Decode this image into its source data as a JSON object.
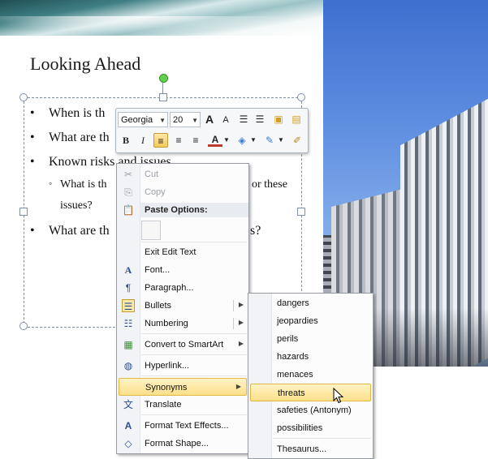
{
  "slide": {
    "title": "Looking Ahead",
    "bullets": [
      "When is th",
      "What are th",
      "Known risks and issues",
      "What is th",
      "or these",
      "issues?",
      "What are th",
      "s?"
    ]
  },
  "mini_toolbar": {
    "font_name": "Georgia",
    "font_size": "20",
    "grow_font": "A",
    "shrink_font": "A",
    "bold": "B",
    "italic": "I",
    "font_color_letter": "A",
    "accent_color": "#c0392b"
  },
  "context_menu": {
    "items": [
      {
        "label": "Cut",
        "disabled": true
      },
      {
        "label": "Copy",
        "disabled": true
      },
      {
        "label": "Paste Options:",
        "header": true
      },
      {
        "label": "Exit Edit Text"
      },
      {
        "label": "Font..."
      },
      {
        "label": "Paragraph..."
      },
      {
        "label": "Bullets"
      },
      {
        "label": "Numbering"
      },
      {
        "label": "Convert to SmartArt"
      },
      {
        "label": "Hyperlink..."
      },
      {
        "label": "Synonyms",
        "highlighted": true
      },
      {
        "label": "Translate"
      },
      {
        "label": "Format Text Effects..."
      },
      {
        "label": "Format Shape..."
      }
    ]
  },
  "synonyms_menu": {
    "items": [
      {
        "label": "dangers"
      },
      {
        "label": "jeopardies"
      },
      {
        "label": "perils"
      },
      {
        "label": "hazards"
      },
      {
        "label": "menaces"
      },
      {
        "label": "threats",
        "highlighted": true
      },
      {
        "label": "safeties (Antonym)"
      },
      {
        "label": "possibilities"
      },
      {
        "label": "Thesaurus..."
      }
    ]
  },
  "colors": {
    "highlight": "#fde08a",
    "selection_border": "#7f8fa6",
    "rotate_handle": "#5fd14b"
  }
}
